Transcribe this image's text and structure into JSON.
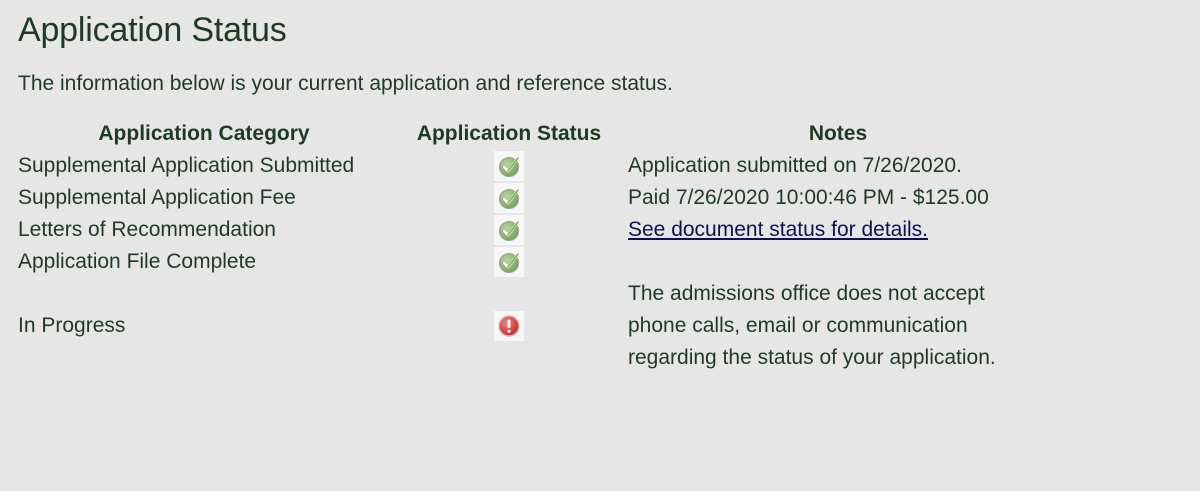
{
  "page": {
    "title": "Application Status",
    "intro": "The information below is your current application and reference status."
  },
  "table": {
    "headers": {
      "category": "Application Category",
      "status": "Application Status",
      "notes": "Notes"
    },
    "rows": [
      {
        "category": "Supplemental Application Submitted",
        "status_icon": "check-icon",
        "notes": "Application submitted on 7/26/2020."
      },
      {
        "category": "Supplemental Application Fee",
        "status_icon": "check-icon",
        "notes": "Paid 7/26/2020 10:00:46 PM - $125.00"
      },
      {
        "category": "Letters of Recommendation",
        "status_icon": "check-icon",
        "notes": "See document status for details."
      },
      {
        "category": "Application File Complete",
        "status_icon": "check-icon",
        "notes": ""
      }
    ],
    "progress": {
      "category": "In Progress",
      "status_icon": "exclamation-icon",
      "notes_line1": "The admissions office does not accept",
      "notes_line2": "phone calls, email or communication",
      "notes_line3": "regarding the status of your application."
    }
  },
  "colors": {
    "text": "#1e3a24",
    "link": "#101050",
    "background": "#e6e6e6",
    "check": "#6fb04a",
    "alert": "#d23a3a"
  }
}
